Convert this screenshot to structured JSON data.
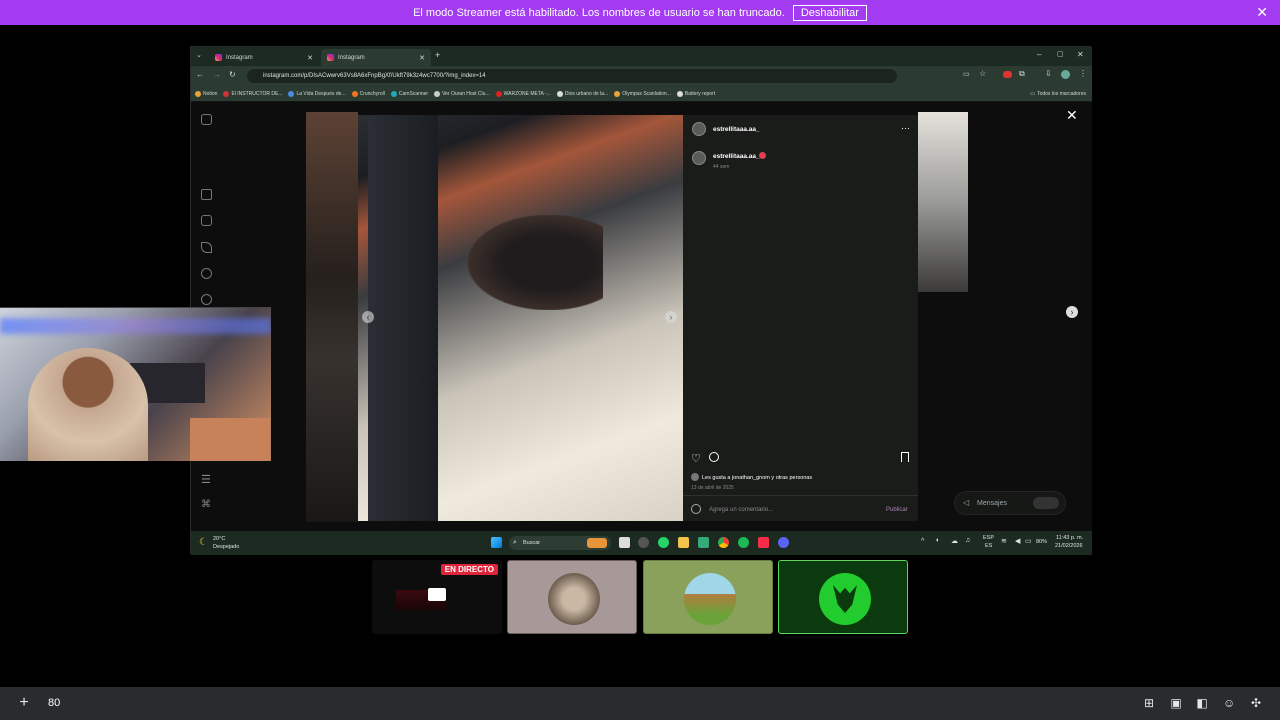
{
  "banner": {
    "message": "El modo Streamer está habilitado. Los nombres de usuario se han truncado.",
    "button_label": "Deshabilitar",
    "color": "#a33cf0"
  },
  "browser": {
    "tabs": [
      {
        "label": "Instagram"
      },
      {
        "label": "Instagram"
      }
    ],
    "url": "instagram.com/p/DIsACwwrv63Vs8A6xFnpBgXf/Ukft79k3z4wc7700/?img_index=14",
    "bookmarks": [
      "Notion",
      "El INSTRUCTOR DE...",
      "La Vida Después de...",
      "Crunchyroll",
      "CamScanner",
      "Ver Ouran Host Clu...",
      "WARZONE META -...",
      "Dios urbano de la...",
      "Olympus Scanlation...",
      "Battery report"
    ],
    "bookmarks_all": "Todos los marcadores"
  },
  "post": {
    "username": "estrellitaaa.aa_",
    "comment_user": "estrellitaaa.aa_",
    "comment_time": "44 sem",
    "likes_text": "Les gusta a jonathan_gnom y otras personas",
    "date": "13 de abril de 2025",
    "comment_placeholder": "Agrega un comentario...",
    "publish_label": "Publicar",
    "messages_label": "Mensajes"
  },
  "taskbar": {
    "weather_temp": "20°C",
    "weather_desc": "Despejado",
    "search_placeholder": "Buscar",
    "lang_top": "ESP",
    "lang_bottom": "ES",
    "battery": "80%",
    "time": "11:43 p. m.",
    "date": "21/02/2026"
  },
  "participants": {
    "live_badge": "EN DIRECTO"
  },
  "bottom_bar": {
    "volume": "80"
  }
}
